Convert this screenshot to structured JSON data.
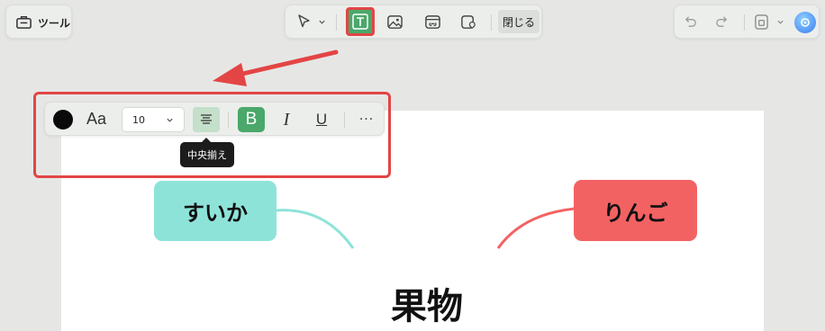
{
  "left_panel": {
    "tool_label": "ツール",
    "tool_icon": "toolbox-icon"
  },
  "toolbar": {
    "tools": [
      {
        "name": "select-tool",
        "icon": "cursor-arrow-icon"
      },
      {
        "name": "text-tool",
        "icon": "text-box-icon",
        "active": true
      },
      {
        "name": "image-tool",
        "icon": "image-icon"
      },
      {
        "name": "link-tool",
        "icon": "link-icon"
      },
      {
        "name": "location-tool",
        "icon": "location-pin-icon"
      }
    ],
    "close_label": "閉じる"
  },
  "right_panel": {
    "undo_icon": "undo-icon",
    "redo_icon": "redo-icon",
    "save_icon": "save-icon",
    "assistant_icon": "ai-assistant-icon"
  },
  "format_toolbar": {
    "color": "#0a0a0a",
    "font_label": "Aa",
    "font_size": "10",
    "bold_label": "B",
    "italic_label": "I",
    "underline_label": "U",
    "more_label": "···"
  },
  "tooltip": {
    "text": "中央揃え"
  },
  "mindmap": {
    "central_topic": "果物",
    "nodes": [
      {
        "label": "すいか",
        "color": "#8ee3d9"
      },
      {
        "label": "りんご",
        "color": "#f36262"
      }
    ]
  },
  "colors": {
    "accent_green": "#4aa86a",
    "highlight_red": "#e34545"
  }
}
